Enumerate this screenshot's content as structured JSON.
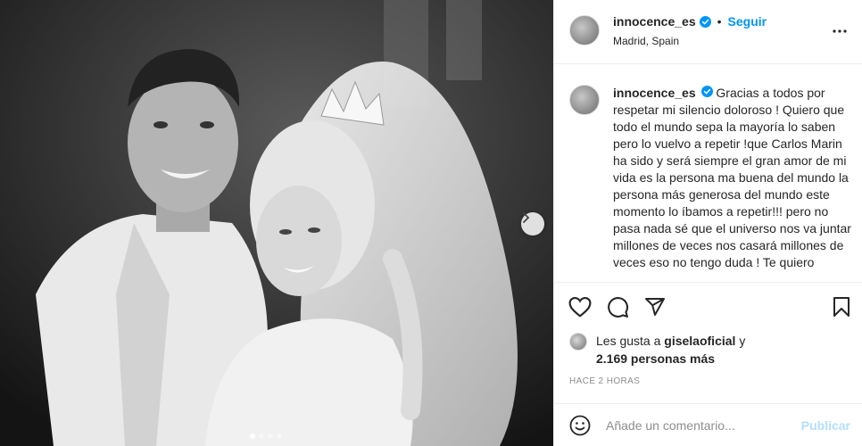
{
  "post": {
    "username": "innocence_es",
    "verified": true,
    "follow_label": "Seguir",
    "separator": "•",
    "location": "Madrid, Spain",
    "caption": "Gracias a todos por respetar mi silencio doloroso ! Quiero que todo el mundo sepa la mayoría lo saben pero lo vuelvo a repetir !que Carlos Marin ha sido y será siempre el gran amor de mi vida es la persona ma buena del mundo la persona más generosa del mundo este momento lo íbamos a repetir!!! pero no pasa nada sé que el universo nos va juntar millones de veces nos casará millones de veces eso no tengo duda ! Te quiero",
    "likes_prefix": "Les gusta a",
    "likes_user": "giselaoficial",
    "likes_conj": "y",
    "likes_count": "2.169 personas más",
    "timestamp": "HACE 2 HORAS",
    "carousel": {
      "count": 4,
      "active": 0
    }
  },
  "comment_box": {
    "placeholder": "Añade un comentario...",
    "post_label": "Publicar"
  },
  "colors": {
    "accent": "#0095f6",
    "accent_disabled": "#b2dffc",
    "text": "#262626",
    "muted": "#8e8e8e",
    "border": "#efefef"
  },
  "icons": [
    "verified-badge-icon",
    "more-options-icon",
    "heart-icon",
    "comment-icon",
    "share-icon",
    "bookmark-icon",
    "emoji-icon",
    "chevron-right-icon"
  ]
}
